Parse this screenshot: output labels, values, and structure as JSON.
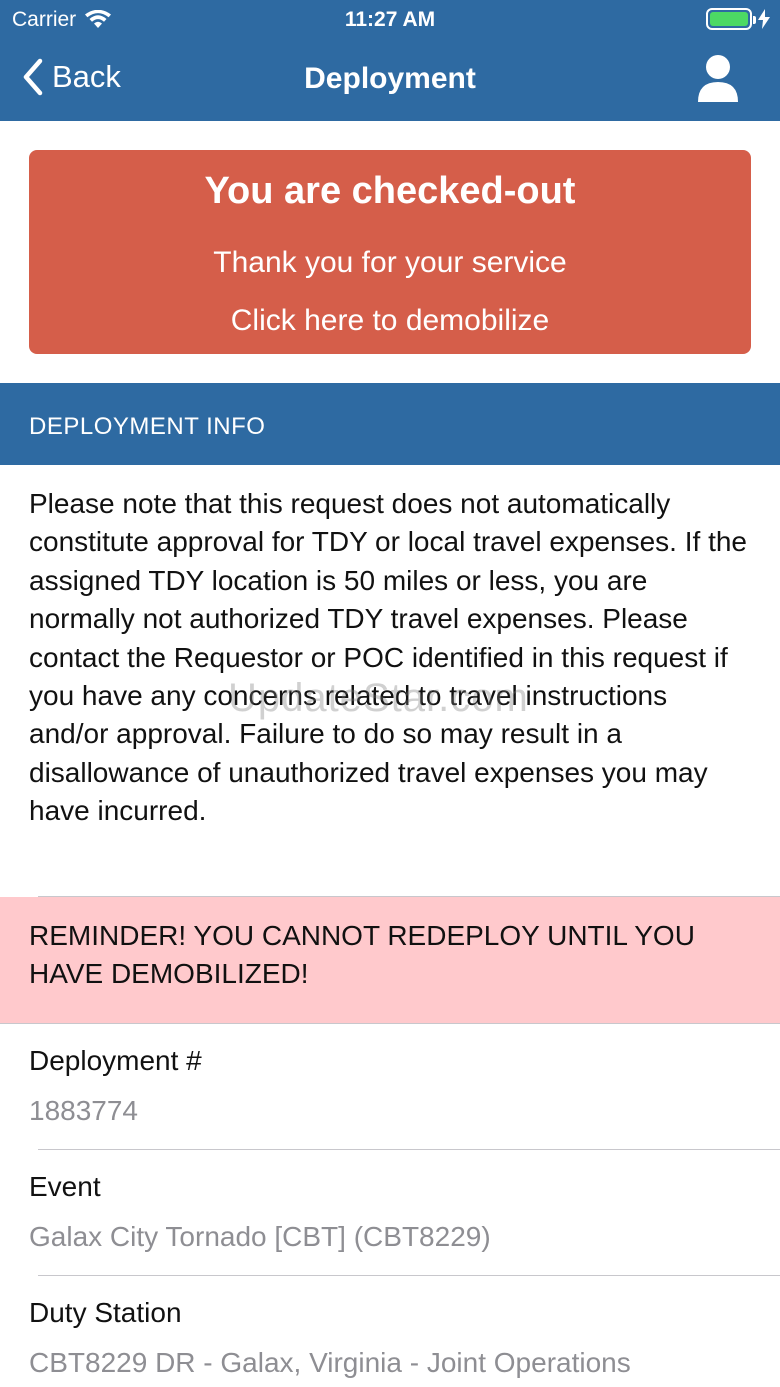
{
  "status_bar": {
    "carrier": "Carrier",
    "time": "11:27 AM",
    "wifi_icon": "wifi-icon",
    "battery_icon": "battery-icon",
    "charging_icon": "bolt-icon"
  },
  "nav": {
    "back_label": "Back",
    "title": "Deployment",
    "user_icon": "user-icon"
  },
  "banner": {
    "title": "You are checked-out",
    "line1": "Thank you for your service",
    "line2": "Click here to demobilize",
    "color": "#d55e4a"
  },
  "section": {
    "header": "DEPLOYMENT INFO"
  },
  "notice": {
    "text": "Please note that this request does not automatically constitute approval for TDY or local travel expenses.  If the assigned TDY location is 50 miles or less, you are normally not authorized TDY travel expenses.  Please contact the Requestor or POC identified in this request if you have any concerns related to travel instructions and/or approval.  Failure to do so may result in a disallowance of unauthorized travel expenses you may have incurred."
  },
  "watermark": "UpdateStar.com",
  "reminder": {
    "text": "REMINDER! YOU CANNOT REDEPLOY UNTIL YOU HAVE DEMOBILIZED!",
    "color": "#ffc9cc"
  },
  "fields": {
    "deployment": {
      "label": "Deployment #",
      "value": "1883774"
    },
    "event": {
      "label": "Event",
      "value": "Galax City Tornado [CBT] (CBT8229)"
    },
    "duty_station": {
      "label": "Duty Station",
      "value": "CBT8229 DR - Galax, Virginia - Joint Operations"
    }
  },
  "colors": {
    "nav_blue": "#2e6aa2",
    "value_gray": "#8e8e93"
  }
}
